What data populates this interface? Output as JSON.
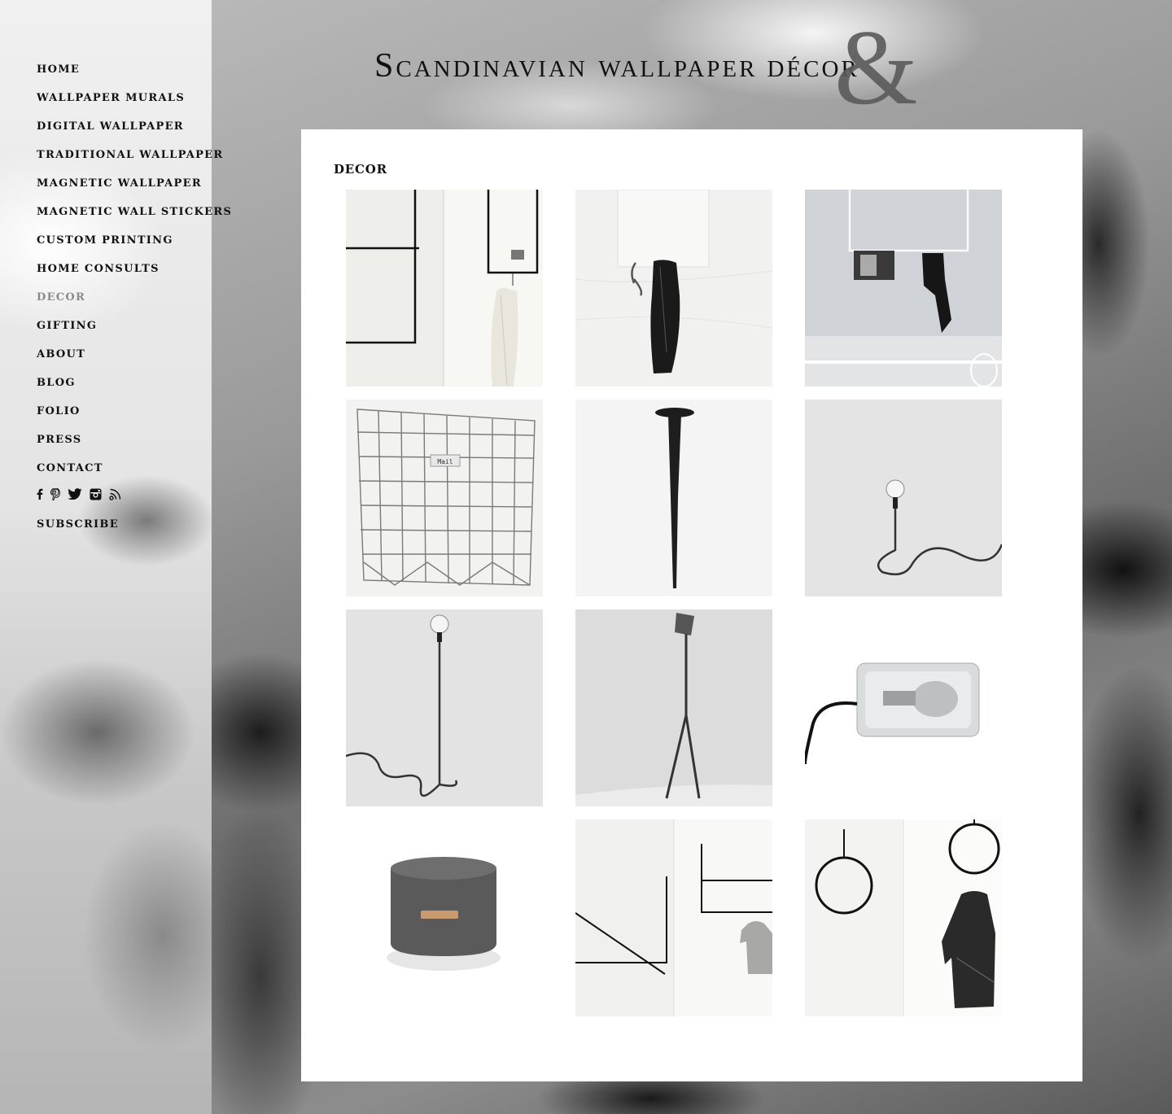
{
  "site": {
    "title_main": "Scandinavian wallpaper",
    "title_amp": "&",
    "title_end": "décor"
  },
  "nav": {
    "items": [
      {
        "label": "HOME"
      },
      {
        "label": "WALLPAPER MURALS"
      },
      {
        "label": "DIGITAL WALLPAPER"
      },
      {
        "label": "TRADITIONAL WALLPAPER"
      },
      {
        "label": "MAGNETIC WALLPAPER"
      },
      {
        "label": "MAGNETIC WALL STICKERS"
      },
      {
        "label": "CUSTOM PRINTING"
      },
      {
        "label": "HOME CONSULTS"
      },
      {
        "label": "DECOR",
        "active": true
      },
      {
        "label": "GIFTING"
      },
      {
        "label": "ABOUT"
      },
      {
        "label": "BLOG"
      },
      {
        "label": "FOLIO"
      },
      {
        "label": "PRESS"
      },
      {
        "label": "CONTACT"
      }
    ],
    "subscribe": "SUBSCRIBE"
  },
  "social": [
    "facebook-icon",
    "pinterest-icon",
    "twitter-icon",
    "instagram-icon",
    "blog-feed-icon"
  ],
  "page": {
    "heading": "DECOR"
  },
  "gallery": {
    "items": [
      {
        "name": "hanging-rack-rail"
      },
      {
        "name": "wall-hook-jacket"
      },
      {
        "name": "ceiling-rack-magazine"
      },
      {
        "name": "wire-basket",
        "tag": "Mail"
      },
      {
        "name": "iron-nail"
      },
      {
        "name": "cord-lamp-small"
      },
      {
        "name": "cord-lamp-tall"
      },
      {
        "name": "floor-lamp-tripod"
      },
      {
        "name": "block-lamp"
      },
      {
        "name": "knitted-pouf"
      },
      {
        "name": "ceiling-rail-tshirt"
      },
      {
        "name": "ring-hanger-blouse"
      }
    ]
  }
}
